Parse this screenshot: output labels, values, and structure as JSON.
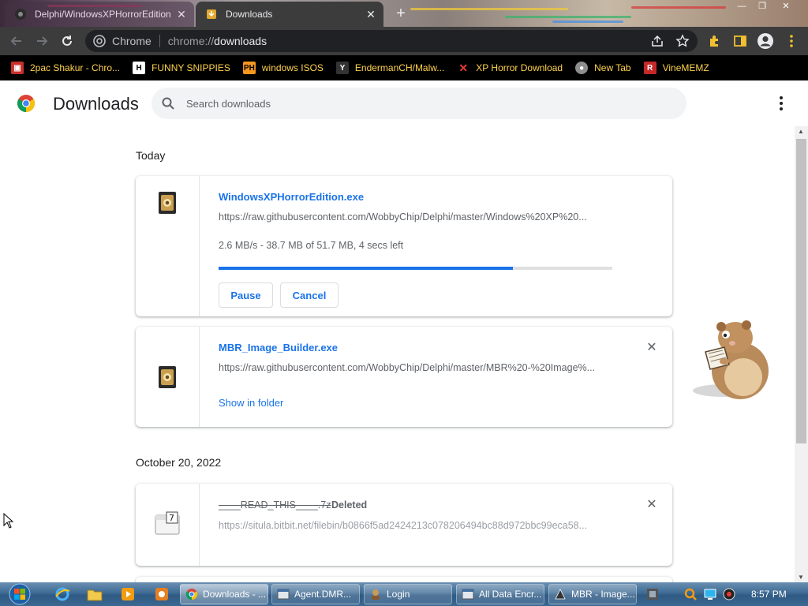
{
  "browser": {
    "tabs": [
      {
        "title": "Delphi/WindowsXPHorrorEdition",
        "active": false
      },
      {
        "title": "Downloads",
        "active": true
      }
    ],
    "omnibox": {
      "chip_label": "Chrome",
      "url_scheme": "chrome://",
      "url_host": "downloads"
    },
    "bookmarks": [
      {
        "label": "2pac Shakur - Chro...",
        "icon": "bookmark-favicon-tupac"
      },
      {
        "label": "FUNNY SNIPPIES",
        "icon": "bookmark-favicon-h"
      },
      {
        "label": "windows ISOS",
        "icon": "bookmark-favicon-ph"
      },
      {
        "label": "EndermanCH/Malw...",
        "icon": "bookmark-favicon-yp"
      },
      {
        "label": "XP Horror Download",
        "icon": "bookmark-favicon-x"
      },
      {
        "label": "New Tab",
        "icon": "bookmark-favicon-globe"
      },
      {
        "label": "VineMEMZ",
        "icon": "bookmark-favicon-r"
      }
    ]
  },
  "page": {
    "title": "Downloads",
    "search_placeholder": "Search downloads"
  },
  "downloads": {
    "groups": [
      {
        "date": "Today",
        "items": [
          {
            "name": "WindowsXPHorrorEdition.exe",
            "url": "https://raw.githubusercontent.com/WobbyChip/Delphi/master/Windows%20XP%20...",
            "status": "2.6 MB/s - 38.7 MB of 51.7 MB, 4 secs left",
            "progress": 0.748,
            "pause_label": "Pause",
            "cancel_label": "Cancel"
          },
          {
            "name": "MBR_Image_Builder.exe",
            "url": "https://raw.githubusercontent.com/WobbyChip/Delphi/master/MBR%20-%20Image%...",
            "show_in_folder_label": "Show in folder"
          }
        ]
      },
      {
        "date": "October 20, 2022",
        "items": [
          {
            "name": "____READ_THIS____.7z",
            "deleted_label": "Deleted",
            "url": "https://situla.bitbit.net/filebin/b0866f5ad2424213c078206494bc88d972bbc99eca58..."
          }
        ]
      }
    ]
  },
  "taskbar": {
    "tasks": [
      {
        "label": "Downloads - ...",
        "icon": "chrome-icon",
        "active": true
      },
      {
        "label": "Agent.DMR...",
        "icon": "window-icon",
        "active": false
      },
      {
        "label": "Login",
        "icon": "login-icon",
        "active": false
      },
      {
        "label": "All Data Encr...",
        "icon": "window-icon",
        "active": false
      },
      {
        "label": "MBR - Image...",
        "icon": "mbr-icon",
        "active": false
      }
    ],
    "clock": "8:57 PM"
  },
  "colors": {
    "accent_blue": "#1a73e8",
    "bookmark_text": "#ffd24d",
    "toolbar_bg": "#3c3c3c"
  }
}
